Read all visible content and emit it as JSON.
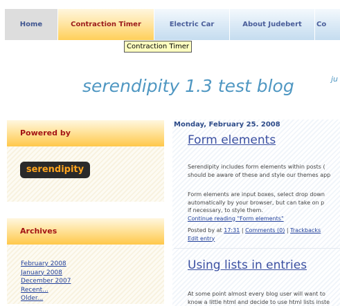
{
  "nav": {
    "home": "Home",
    "contraction_timer": "Contraction Timer",
    "electric_car": "Electric Car",
    "about": "About Judebert",
    "more": "Co"
  },
  "tooltip": "Contraction Timer",
  "blog": {
    "title": "serendipity 1.3 test blog",
    "subtitle_fragment": "ju"
  },
  "sidebar": {
    "powered_by": {
      "title": "Powered by",
      "logo_text": "serendipity"
    },
    "archives": {
      "title": "Archives",
      "items": [
        "February 2008",
        "January 2008",
        "December 2007",
        "Recent...",
        "Older..."
      ]
    }
  },
  "main": {
    "date": "Monday, February 25. 2008",
    "entries": [
      {
        "title": "Form elements",
        "paragraph1": [
          "Serendipity includes form elements within posts (",
          "should be aware of these and style our themes app"
        ],
        "paragraph2": [
          "Form elements are input boxes, select drop down",
          "automatically by your browser, but can take on p",
          "if necessary, to style them."
        ],
        "continue_link": "Continue reading \"Form elements\"",
        "meta": {
          "posted_by": "Posted by",
          "at": "at",
          "time": "17:31",
          "comments": "Comments (0)",
          "trackbacks": "Trackbacks",
          "edit": "Edit entry"
        }
      },
      {
        "title": "Using lists in entries",
        "paragraph1": [
          "At some point almost every blog user will want to",
          "know a little html and decide to use html lists inste"
        ]
      }
    ]
  },
  "colors": {
    "accent_blue": "#4f97c2",
    "link_blue": "#1f3e9a",
    "sidebar_title_red": "#a31414"
  }
}
